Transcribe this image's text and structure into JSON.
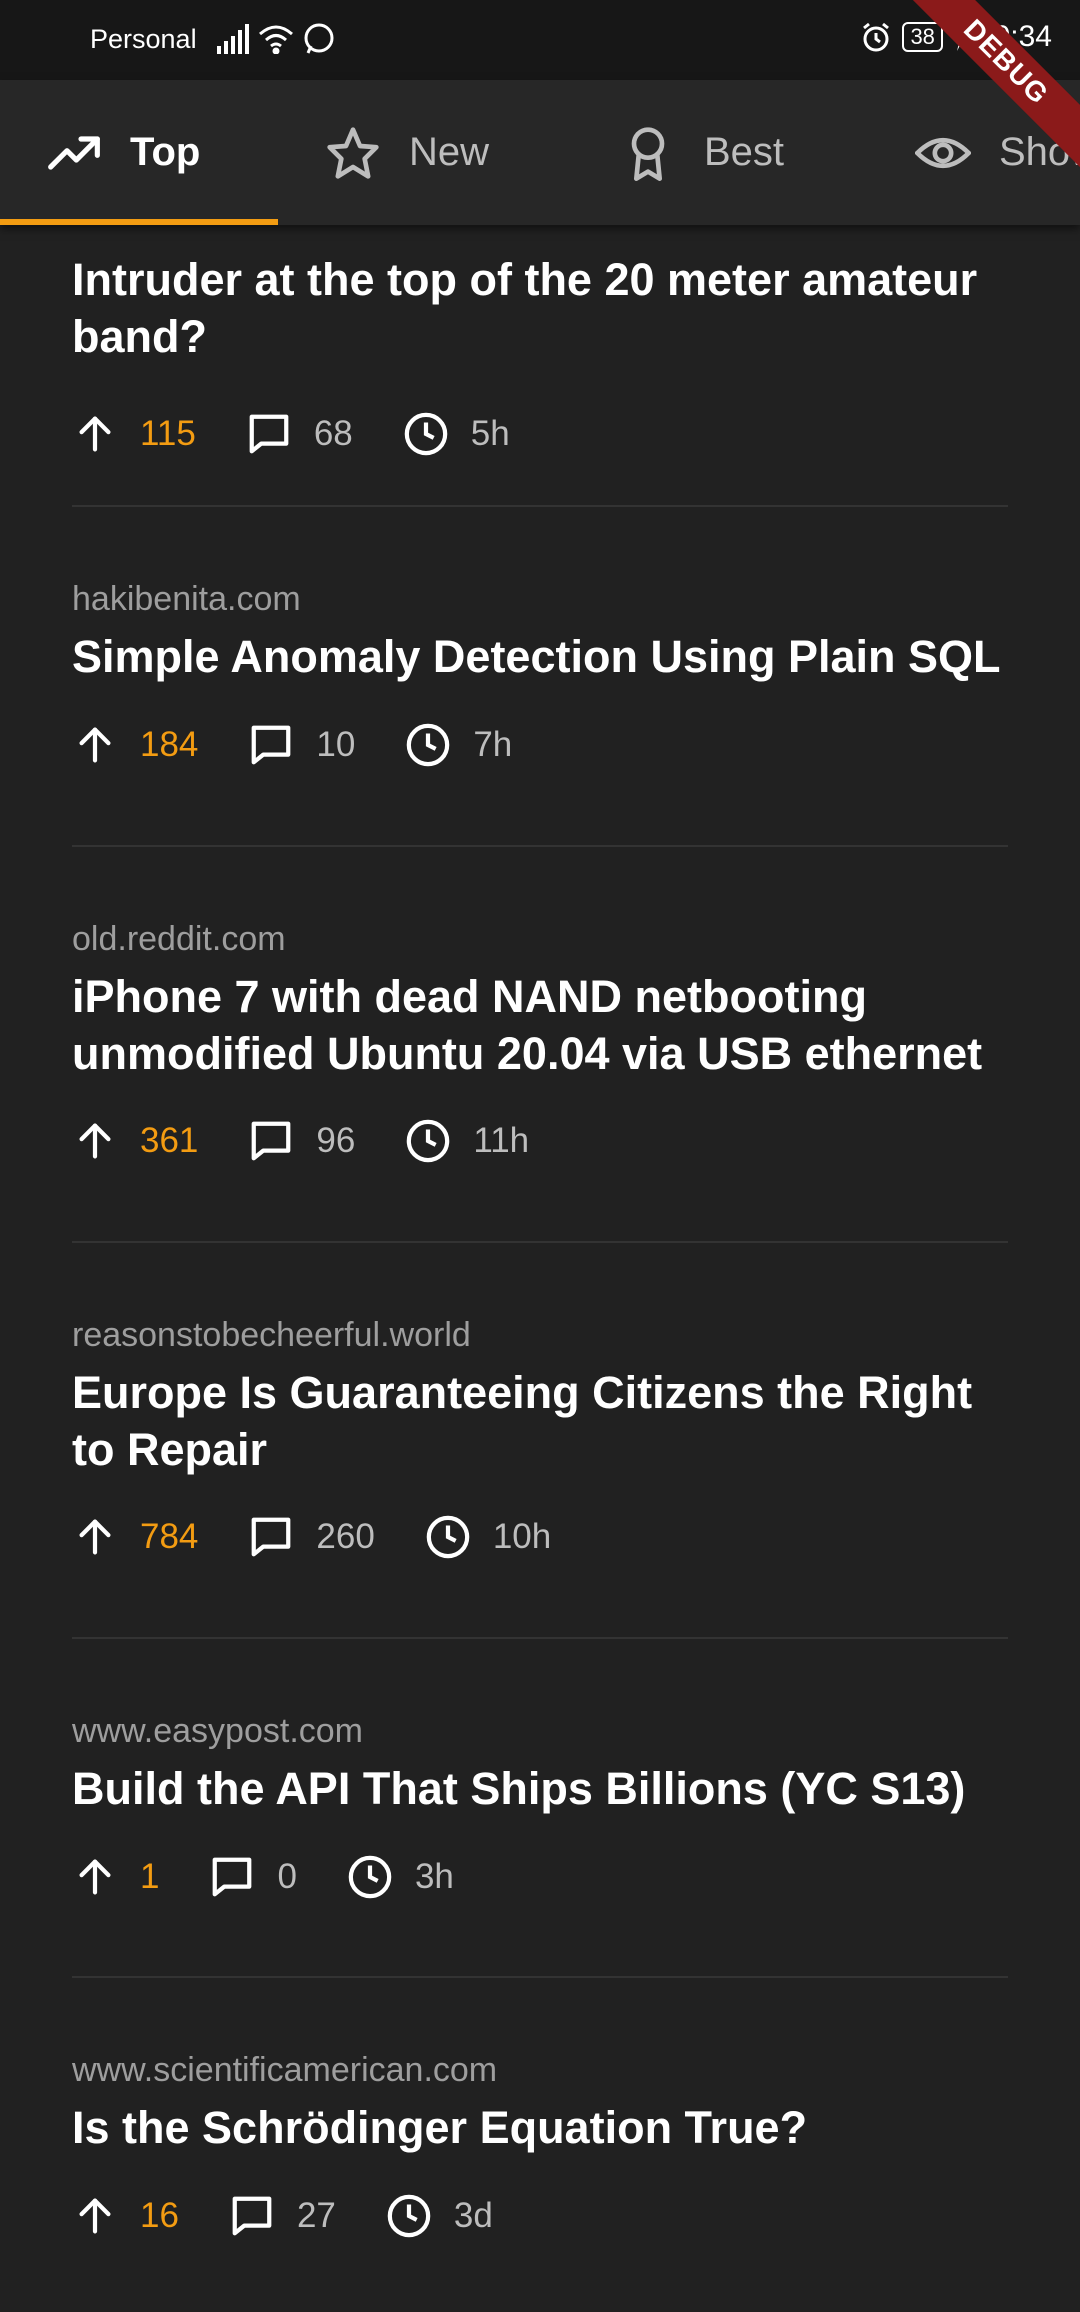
{
  "status_bar": {
    "carrier": "Personal",
    "battery": "38",
    "time": "20:34"
  },
  "debug_banner": "DEBUG",
  "tabs": [
    {
      "label": "Top",
      "icon": "trending-up-icon",
      "active": true
    },
    {
      "label": "New",
      "icon": "star-icon"
    },
    {
      "label": "Best",
      "icon": "award-icon"
    },
    {
      "label": "Show",
      "icon": "eye-icon"
    }
  ],
  "stories": [
    {
      "domain": "",
      "title": "Intruder at the top of the 20 meter amateur band?",
      "score": "115",
      "comments": "68",
      "age": "5h"
    },
    {
      "domain": "hakibenita.com",
      "title": "Simple Anomaly Detection Using Plain SQL",
      "score": "184",
      "comments": "10",
      "age": "7h"
    },
    {
      "domain": "old.reddit.com",
      "title": "iPhone 7 with dead NAND netbooting unmodified Ubuntu 20.04 via USB ethernet",
      "score": "361",
      "comments": "96",
      "age": "11h"
    },
    {
      "domain": "reasonstobecheerful.world",
      "title": "Europe Is Guaranteeing Citizens the Right to Repair",
      "score": "784",
      "comments": "260",
      "age": "10h"
    },
    {
      "domain": "www.easypost.com",
      "title": "Build the API That Ships Billions (YC S13)",
      "score": "1",
      "comments": "0",
      "age": "3h"
    },
    {
      "domain": "www.scientificamerican.com",
      "title": "Is the Schrödinger Equation True?",
      "score": "16",
      "comments": "27",
      "age": "3d"
    }
  ],
  "colors": {
    "accent": "#f39c12",
    "background": "#212121",
    "tab_bar": "#272727"
  }
}
